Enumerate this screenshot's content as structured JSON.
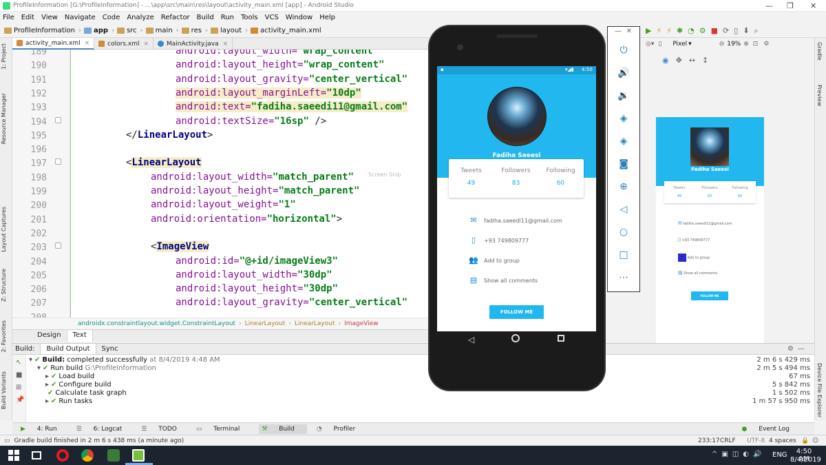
{
  "titlebar": {
    "text": "ProfileInformation [G:\\ProfileInformation] - ...\\app\\src\\main\\res\\layout\\activity_main.xml [app] - Android Studio"
  },
  "menu": [
    "File",
    "Edit",
    "View",
    "Navigate",
    "Code",
    "Analyze",
    "Refactor",
    "Build",
    "Run",
    "Tools",
    "VCS",
    "Window",
    "Help"
  ],
  "breadcrumbs": [
    "ProfileInformation",
    "app",
    "src",
    "main",
    "res",
    "layout",
    "activity_main.xml"
  ],
  "tabs": [
    {
      "label": "activity_main.xml",
      "color": "#d08a3a"
    },
    {
      "label": "colors.xml",
      "color": "#d08a3a"
    },
    {
      "label": "MainActivity.java",
      "color": "#3e86c7"
    }
  ],
  "editor": {
    "lines": [
      {
        "n": "189",
        "segs": [
          {
            "c": "ak",
            "t": "android:layout_width="
          },
          {
            "c": "av",
            "t": "\"wrap_content\""
          }
        ],
        "indent": 4
      },
      {
        "n": "190",
        "segs": [
          {
            "c": "ak",
            "t": "android:layout_height="
          },
          {
            "c": "av",
            "t": "\"wrap_content\""
          }
        ],
        "indent": 4
      },
      {
        "n": "191",
        "segs": [
          {
            "c": "ak",
            "t": "android:layout_gravity="
          },
          {
            "c": "av",
            "t": "\"center_vertical\""
          }
        ],
        "indent": 4
      },
      {
        "n": "192",
        "segs": [
          {
            "c": "ak hl",
            "t": "android:layout_marginLeft="
          },
          {
            "c": "av hl",
            "t": "\"10dp\""
          }
        ],
        "indent": 4
      },
      {
        "n": "193",
        "segs": [
          {
            "c": "ak hl",
            "t": "android:text="
          },
          {
            "c": "av hl",
            "t": "\"fadiha.saeedi11@gmail.com\""
          }
        ],
        "indent": 4
      },
      {
        "n": "194",
        "segs": [
          {
            "c": "ak",
            "t": "android:textSize="
          },
          {
            "c": "av",
            "t": "\"16sp\""
          },
          {
            "c": "",
            "t": " />"
          }
        ],
        "indent": 4
      },
      {
        "n": "195",
        "segs": [
          {
            "c": "",
            "t": "</"
          },
          {
            "c": "tg",
            "t": "LinearLayout"
          },
          {
            "c": "",
            "t": ">"
          }
        ],
        "indent": 2
      },
      {
        "n": "196",
        "segs": [],
        "indent": 0
      },
      {
        "n": "197",
        "segs": [
          {
            "c": "",
            "t": "<"
          },
          {
            "c": "tg hl",
            "t": "LinearLayout"
          }
        ],
        "indent": 2
      },
      {
        "n": "198",
        "segs": [
          {
            "c": "ak",
            "t": "android:layout_width="
          },
          {
            "c": "av",
            "t": "\"match_parent\""
          }
        ],
        "indent": 3
      },
      {
        "n": "199",
        "segs": [
          {
            "c": "ak",
            "t": "android:layout_height="
          },
          {
            "c": "av",
            "t": "\"match_parent\""
          }
        ],
        "indent": 3
      },
      {
        "n": "200",
        "segs": [
          {
            "c": "ak",
            "t": "android:layout_weight="
          },
          {
            "c": "av",
            "t": "\"1\""
          }
        ],
        "indent": 3
      },
      {
        "n": "201",
        "segs": [
          {
            "c": "ak",
            "t": "android:orientation="
          },
          {
            "c": "av",
            "t": "\"horizontal\""
          },
          {
            "c": "",
            "t": ">"
          }
        ],
        "indent": 3
      },
      {
        "n": "202",
        "segs": [],
        "indent": 0
      },
      {
        "n": "203",
        "segs": [
          {
            "c": "",
            "t": "<"
          },
          {
            "c": "tg hl",
            "t": "ImageView"
          }
        ],
        "indent": 3
      },
      {
        "n": "204",
        "segs": [
          {
            "c": "ak",
            "t": "android:id="
          },
          {
            "c": "av",
            "t": "\"@+id/imageView3\""
          }
        ],
        "indent": 4
      },
      {
        "n": "205",
        "segs": [
          {
            "c": "ak",
            "t": "android:layout_width="
          },
          {
            "c": "av",
            "t": "\"30dp\""
          }
        ],
        "indent": 4
      },
      {
        "n": "206",
        "segs": [
          {
            "c": "ak",
            "t": "android:layout_height="
          },
          {
            "c": "av",
            "t": "\"30dp\""
          }
        ],
        "indent": 4
      },
      {
        "n": "207",
        "segs": [
          {
            "c": "ak",
            "t": "android:layout_gravity="
          },
          {
            "c": "av",
            "t": "\"center_vertical\""
          }
        ],
        "indent": 4
      },
      {
        "n": "208",
        "segs": [],
        "indent": 0
      }
    ]
  },
  "structure_crumbs": [
    "androidx.constraintlayout.widget.ConstraintLayout",
    "LinearLayout",
    "LinearLayout",
    "ImageView"
  ],
  "design_tabs": [
    "Design",
    "Text"
  ],
  "build": {
    "header_label": "Build:",
    "tab1": "Build Output",
    "tab2": "Sync",
    "rows": [
      {
        "text": "Build:",
        "rest": " completed successfully",
        "dim": " at 8/4/2019 4:48 AM",
        "time": "2 m 6 s 429 ms"
      },
      {
        "text": "Run build",
        "dim": " G:\\ProfileInformation",
        "time": "2 m 5 s 494 ms"
      },
      {
        "text": "Load build",
        "time": "67 ms"
      },
      {
        "text": "Configure build",
        "time": "5 s 842 ms"
      },
      {
        "text": "Calculate task graph",
        "time": "1 s 502 ms"
      },
      {
        "text": "Run tasks",
        "time": "1 m 57 s 950 ms"
      }
    ]
  },
  "bottom_tools": [
    "4: Run",
    "6: Logcat",
    "TODO",
    "Terminal",
    "Build",
    "Profiler"
  ],
  "event_log": "Event Log",
  "status": {
    "message": "Gradle build finished in 2 m 6 s 438 ms (a minute ago)",
    "position": "233:17",
    "line_sep": "CRLF",
    "encoding": "UTF-8",
    "indent": "4 spaces"
  },
  "taskbar": {
    "lang": "ENG",
    "time": "4:50 AM",
    "date": "8/4/2019"
  },
  "phone": {
    "status_time": "4:50",
    "name": "Fadiha Saeesi",
    "stats": [
      {
        "label": "Tweets",
        "value": "49"
      },
      {
        "label": "Followers",
        "value": "83"
      },
      {
        "label": "Following",
        "value": "60"
      }
    ],
    "rows": [
      {
        "icon": "✉",
        "text": "fadiha.saeedi11@gmail.com"
      },
      {
        "icon": "▯",
        "text": "+93 749809777"
      },
      {
        "icon": "👥",
        "text": "Add to group"
      },
      {
        "icon": "▤",
        "text": "Show all comments"
      }
    ],
    "follow_button": "FOLLOW ME"
  },
  "preview": {
    "device": "Pixel",
    "zoom": "19%",
    "name": "Fadiha Saeesi",
    "stats": [
      {
        "label": "Tweets",
        "value": "49"
      },
      {
        "label": "Followers",
        "value": "83"
      },
      {
        "label": "Following",
        "value": "60"
      }
    ],
    "rows": [
      "fadiha.saeedi11@gmail.com",
      "+93 749809777",
      "Add to group",
      "Show all comments"
    ],
    "follow_button": "FOLLOW ME"
  },
  "side_labels": {
    "left": [
      "1: Project",
      "Resource Manager",
      "Layout Captures",
      "Z: Structure",
      "2: Favorites",
      "Build Variants"
    ],
    "right": [
      "Gradle",
      "Preview",
      "Device File Explorer"
    ]
  },
  "ghost_text": "Screen Snip"
}
